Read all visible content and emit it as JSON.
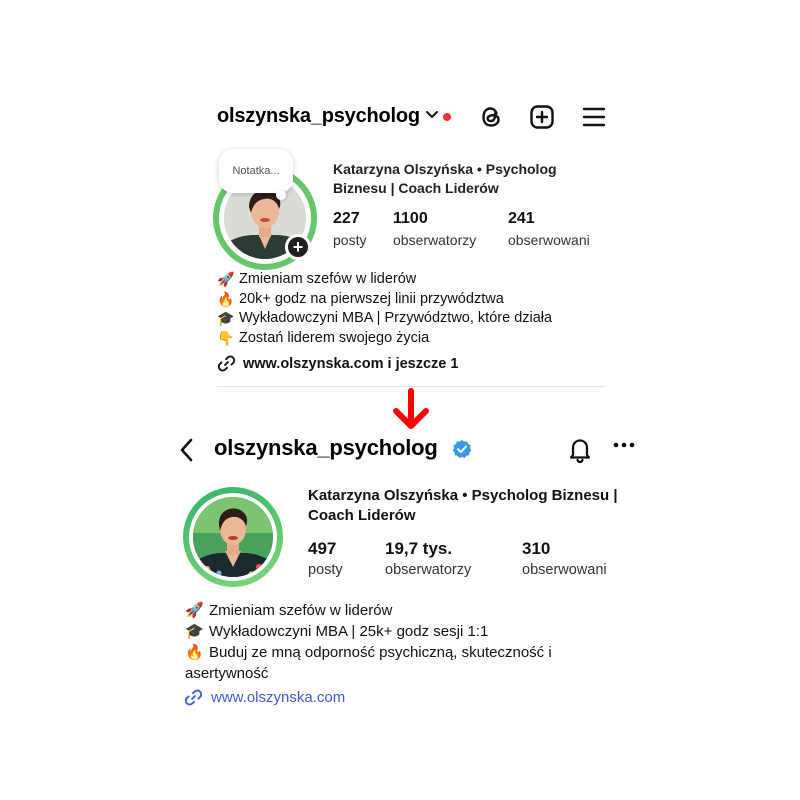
{
  "old_profile": {
    "username": "olszynska_psycholog",
    "icons": {
      "chevron": "chevron-down-icon",
      "notification_dot": "red-dot-icon",
      "threads": "threads-icon",
      "create": "plus-square-icon",
      "menu": "hamburger-menu-icon"
    },
    "note_placeholder": "Notatka...",
    "add_story": "+",
    "display_name": "Katarzyna Olszyńska • Psycholog Biznesu | Coach Liderów",
    "stats": [
      {
        "value": "227",
        "label": "posty"
      },
      {
        "value": "1100",
        "label": "obserwatorzy"
      },
      {
        "value": "241",
        "label": "obserwowani"
      }
    ],
    "bio": [
      {
        "emoji": "🚀",
        "text": "Zmieniam szefów w liderów"
      },
      {
        "emoji": "🔥",
        "text": "20k+ godz na pierwszej linii przywództwa"
      },
      {
        "emoji": "🎓",
        "text": "Wykładowczyni MBA | Przywództwo, które działa"
      },
      {
        "emoji": "👇",
        "text": "Zostań liderem swojego życia"
      }
    ],
    "link": "www.olszynska.com i jeszcze 1"
  },
  "new_profile": {
    "username": "olszynska_psycholog",
    "icons": {
      "back": "chevron-left-icon",
      "verified": "verified-badge-icon",
      "bell": "bell-icon",
      "more": "more-horizontal-icon",
      "link": "link-icon"
    },
    "display_name": "Katarzyna Olszyńska • Psycholog Biznesu | Coach Liderów",
    "stats": [
      {
        "value": "497",
        "label": "posty"
      },
      {
        "value": "19,7 tys.",
        "label": "obserwatorzy"
      },
      {
        "value": "310",
        "label": "obserwowani"
      }
    ],
    "bio": [
      {
        "emoji": "🚀",
        "text": "Zmieniam szefów w liderów"
      },
      {
        "emoji": "🎓",
        "text": "Wykładowczyni MBA | 25k+ godz sesji 1:1"
      },
      {
        "emoji": "🔥",
        "text": "Buduj ze mną odporność psychiczną, skuteczność i asertywność"
      }
    ],
    "link": "www.olszynska.com"
  },
  "colors": {
    "arrow": "#ff0000",
    "verified": "#3897f0",
    "link": "#3b5bdb",
    "story_ring_old": "#67c66d",
    "story_ring_new": "#35b46a"
  }
}
